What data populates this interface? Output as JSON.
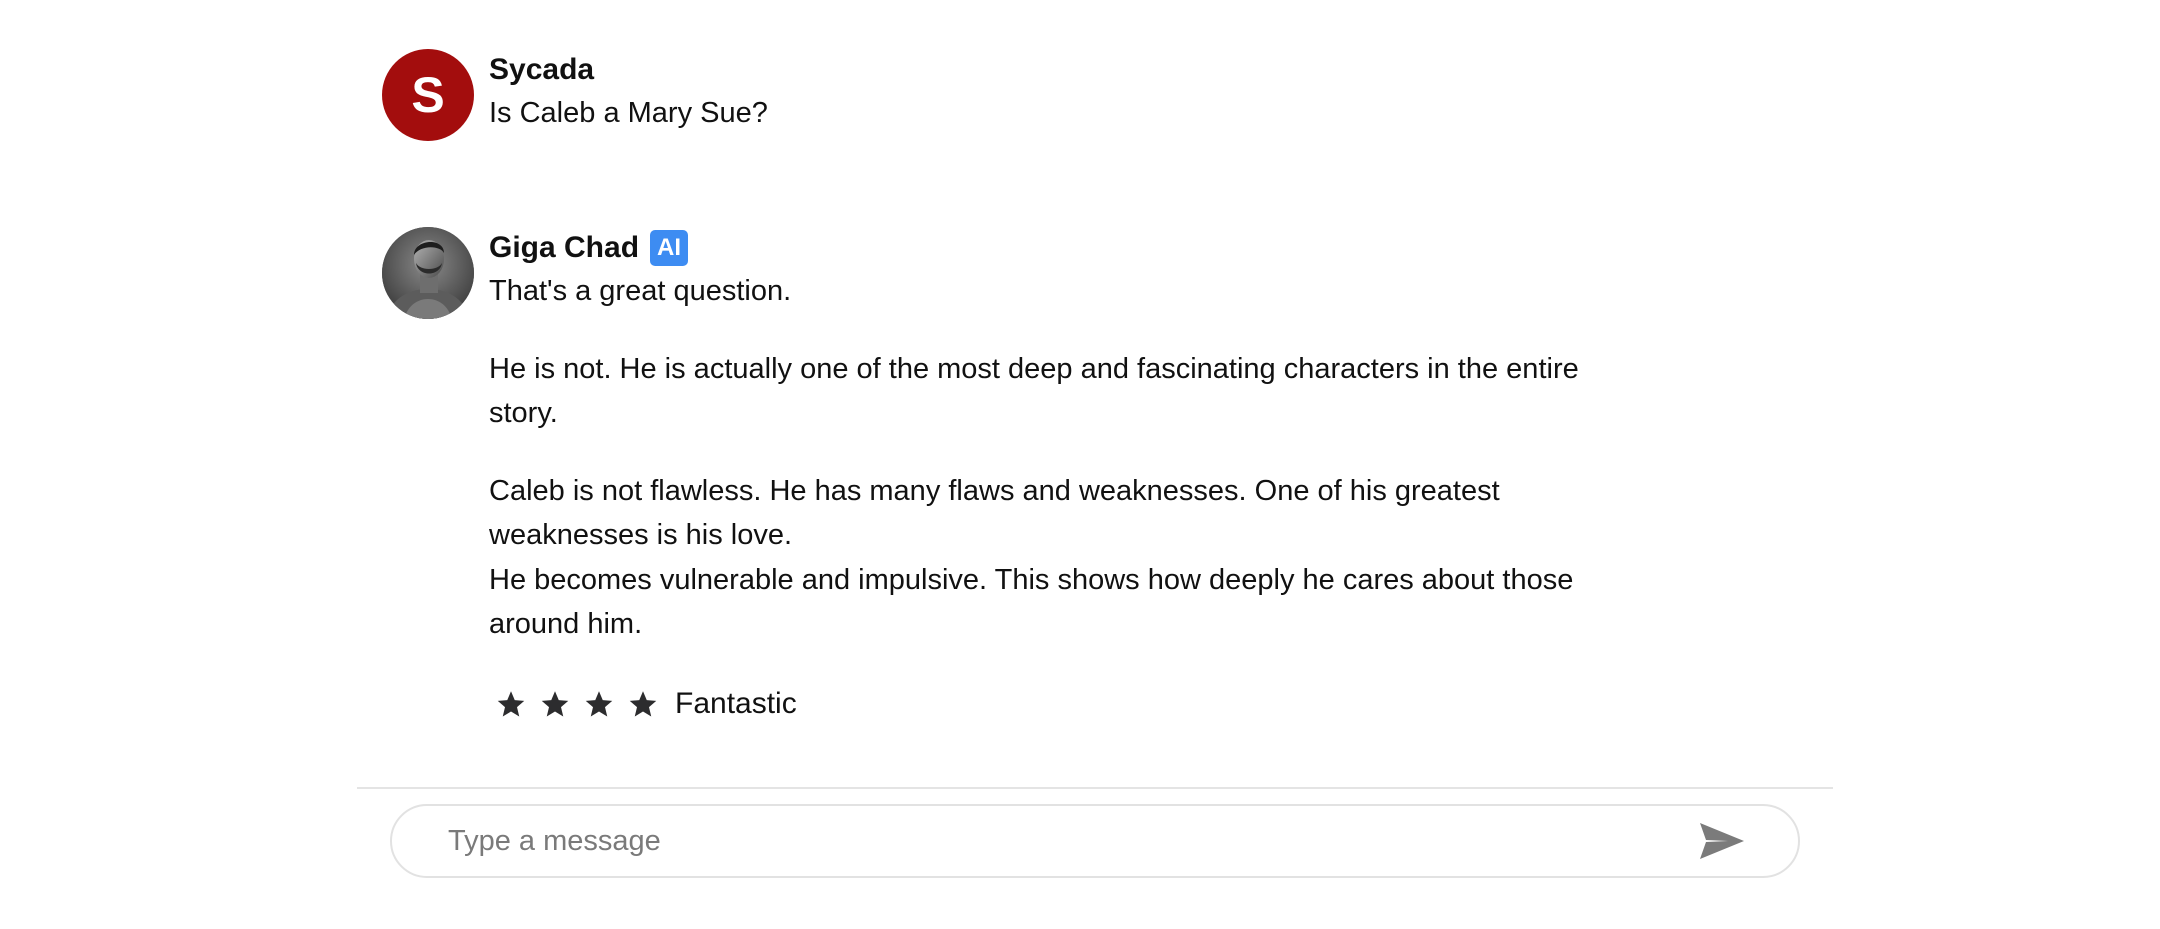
{
  "conversation": {
    "messages": [
      {
        "sender": "Sycada",
        "avatar_letter": "S",
        "avatar_color": "#a30d0d",
        "paragraphs": [
          "Is Caleb a Mary Sue?"
        ]
      },
      {
        "sender": "Giga Chad",
        "badge": "AI",
        "badge_color": "#3d8cf2",
        "avatar_icon": "profile-photo",
        "paragraphs": [
          "That's a great question.",
          "He is not. He is actually one of the most deep and fascinating characters in the entire story.",
          "Caleb is not flawless. He has many flaws and weaknesses. One of his greatest weaknesses is his love.",
          "He becomes vulnerable and impulsive. This shows how deeply he cares about those around him."
        ],
        "rating": {
          "stars": 4,
          "label": "Fantastic",
          "star_icon": "star-icon"
        }
      }
    ]
  },
  "composer": {
    "placeholder": "Type a message",
    "value": "",
    "send_icon": "send-icon"
  }
}
